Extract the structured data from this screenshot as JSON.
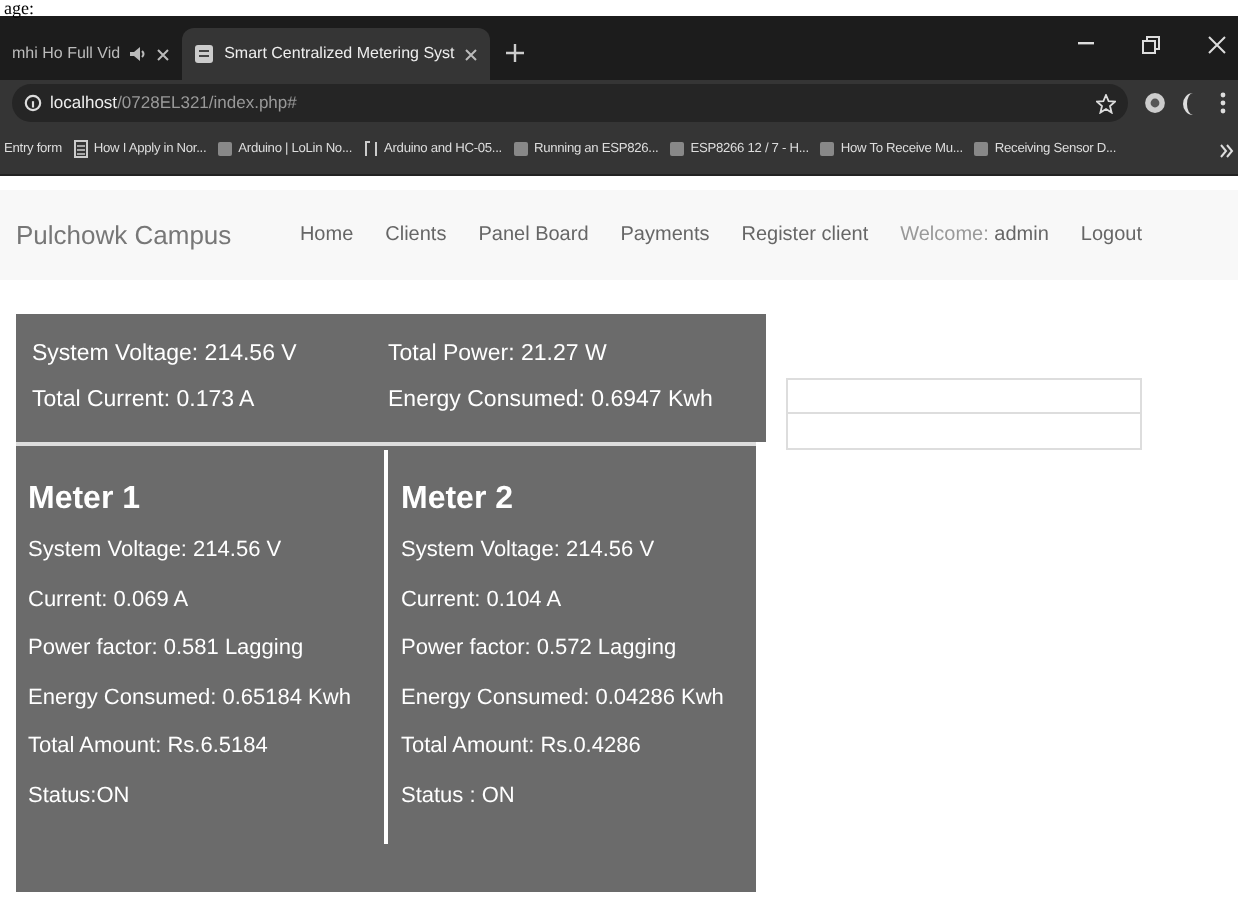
{
  "caption_fragment": "age:",
  "tabs": [
    {
      "title": "mhi Ho Full Vid",
      "selected": false,
      "kind": "audio"
    },
    {
      "title": "Smart Centralized Metering Syst",
      "selected": true,
      "kind": "page"
    }
  ],
  "address": {
    "host": "localhost",
    "path": "/0728EL321/index.php#"
  },
  "bookmarks": [
    {
      "label": "Entry form",
      "kind": "none"
    },
    {
      "label": "How I Apply in Nor...",
      "kind": "doc"
    },
    {
      "label": "Arduino | LoLin No...",
      "kind": "page"
    },
    {
      "label": "Arduino and HC-05...",
      "kind": "pin"
    },
    {
      "label": "Running an ESP826...",
      "kind": "page"
    },
    {
      "label": "ESP8266 12 / 7 - H...",
      "kind": "page"
    },
    {
      "label": "How To Receive Mu...",
      "kind": "page"
    },
    {
      "label": "Receiving Sensor D...",
      "kind": "page"
    }
  ],
  "navbar": {
    "brand": "Pulchowk Campus",
    "links": [
      "Home",
      "Clients",
      "Panel Board",
      "Payments",
      "Register client"
    ],
    "welcome": "Welcome:",
    "user": "admin",
    "logout": "Logout"
  },
  "summary": [
    [
      "System Voltage: 214.56 V",
      "Total Current: 0.173 A"
    ],
    [
      "Total Power: 21.27 W",
      "Energy Consumed: 0.6947 Kwh"
    ]
  ],
  "meters": [
    {
      "title": "Meter 1",
      "lines": [
        "System Voltage: 214.56 V",
        "Current: 0.069 A",
        "Power factor: 0.581 Lagging",
        "Energy Consumed: 0.65184 Kwh",
        "Total Amount: Rs.6.5184",
        "Status:ON"
      ]
    },
    {
      "title": "Meter 2",
      "lines": [
        "System Voltage: 214.56 V",
        "Current: 0.104 A",
        "Power factor: 0.572 Lagging",
        "Energy Consumed: 0.04286 Kwh",
        "Total Amount: Rs.0.4286",
        "Status : ON"
      ]
    }
  ]
}
